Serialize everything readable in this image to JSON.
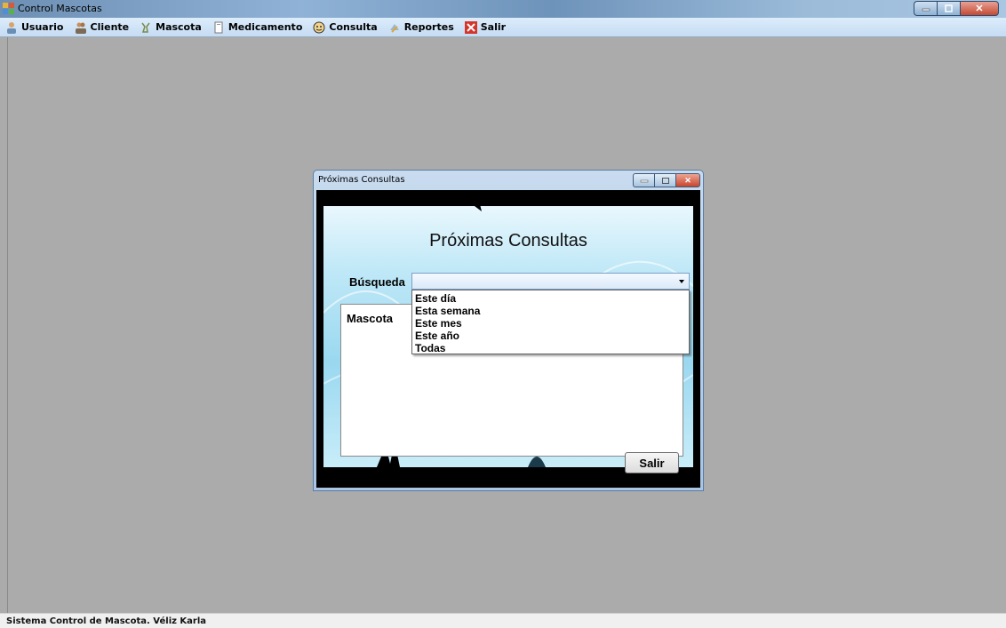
{
  "window": {
    "title": "Control Mascotas"
  },
  "menu": {
    "items": [
      {
        "label": "Usuario",
        "icon": "user-icon"
      },
      {
        "label": "Cliente",
        "icon": "clients-icon"
      },
      {
        "label": "Mascota",
        "icon": "pet-icon"
      },
      {
        "label": "Medicamento",
        "icon": "medicine-icon"
      },
      {
        "label": "Consulta",
        "icon": "consult-icon"
      },
      {
        "label": "Reportes",
        "icon": "reports-icon"
      },
      {
        "label": "Salir",
        "icon": "exit-icon"
      }
    ]
  },
  "dialog": {
    "title": "Próximas Consultas",
    "heading": "Próximas Consultas",
    "search_label": "Búsqueda",
    "search_value": "",
    "options": [
      "Este día",
      "Esta semana",
      "Este mes",
      "Este año",
      "Todas"
    ],
    "grid_column": "Mascota",
    "exit_button": "Salir"
  },
  "status": {
    "text": "Sistema Control de Mascota. Véliz Karla"
  },
  "colors": {
    "mdi_background": "#ababab",
    "menubar": "#cfe3f7",
    "panel": "#9ad8f0"
  }
}
